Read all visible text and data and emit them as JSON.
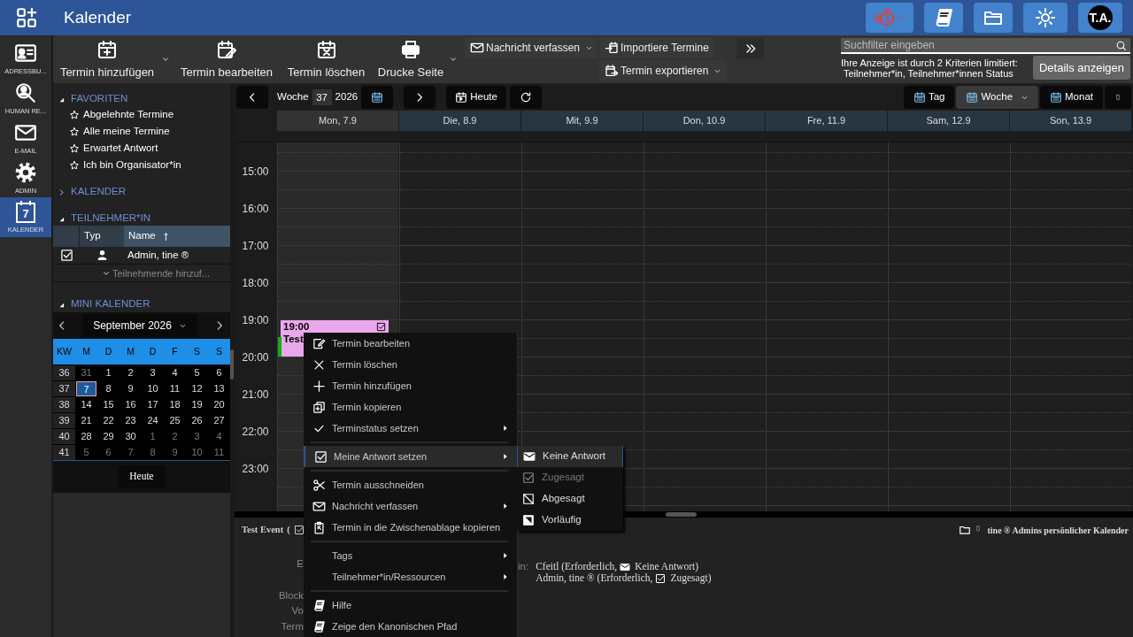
{
  "app": {
    "title": "Kalender"
  },
  "header_buttons": [
    {
      "kind": "stopwatch",
      "dropdown": true
    },
    {
      "kind": "book",
      "dropdown": false
    },
    {
      "kind": "folder-open",
      "dropdown": false
    },
    {
      "kind": "sun",
      "dropdown": false
    }
  ],
  "user": {
    "initials": "T.A."
  },
  "nav": [
    {
      "label": "ADRESSBU...",
      "kind": "address-card",
      "selected": false
    },
    {
      "label": "HUMAN RE...",
      "kind": "person-search",
      "selected": false
    },
    {
      "label": "E-MAIL",
      "kind": "envelope",
      "selected": false
    },
    {
      "label": "ADMIN",
      "kind": "gear",
      "selected": false
    },
    {
      "label": "KALENDER",
      "kind": "calendar",
      "icon_text": "7",
      "selected": true
    }
  ],
  "toolbar": {
    "buttons": [
      {
        "label": "Termin hinzufügen",
        "kind": "calendar-plus",
        "dropdown": true
      },
      {
        "label": "Termin bearbeiten",
        "kind": "calendar-edit",
        "dropdown": false
      },
      {
        "label": "Termin löschen",
        "kind": "calendar-x",
        "dropdown": false
      },
      {
        "label": "Drucke Seite",
        "kind": "printer",
        "dropdown": true
      }
    ],
    "actions": [
      {
        "label": "Nachricht verfassen",
        "kind": "envelope",
        "dropdown": true
      },
      {
        "label": "Importiere Termine",
        "kind": "import",
        "dropdown": false
      },
      {
        "label": "Termin exportieren",
        "kind": "export",
        "dropdown": true
      }
    ],
    "search": {
      "placeholder": "Suchfilter eingeben"
    },
    "filter_notice": [
      "Ihre Anzeige ist durch 2 Kriterien limitiert:",
      "Teilnehmer*in, Teilnehmer*innen Status"
    ],
    "details_button": "Details anzeigen"
  },
  "favorites": {
    "title": "FAVORITEN",
    "expanded": true,
    "items": [
      "Abgelehnte Termine",
      "Alle meine Termine",
      "Erwartet Antwort",
      "Ich bin Organisator*in"
    ]
  },
  "calendars": {
    "title": "KALENDER",
    "expanded": false
  },
  "attendees": {
    "title": "TEILNEHMER*IN",
    "expanded": true,
    "columns": [
      {
        "label": "Typ",
        "sorted": false
      },
      {
        "label": "Name",
        "sorted": true
      }
    ],
    "rows": [
      {
        "checked": true,
        "kind": "user",
        "name": "Admin, tine ®"
      }
    ],
    "add_placeholder": "Teilnehmende hinzuf..."
  },
  "mini_calendar": {
    "title": "MINI KALENDER",
    "expanded": true,
    "month": "September 2026",
    "weekday_header": [
      "KW",
      "M",
      "D",
      "M",
      "D",
      "F",
      "S",
      "S"
    ],
    "weeks": [
      {
        "kw": "36",
        "days": [
          {
            "d": "31",
            "muted": true,
            "selected": false
          },
          {
            "d": "1",
            "muted": false,
            "selected": false
          },
          {
            "d": "2",
            "muted": false,
            "selected": false
          },
          {
            "d": "3",
            "muted": false,
            "selected": false
          },
          {
            "d": "4",
            "muted": false,
            "selected": false
          },
          {
            "d": "5",
            "muted": false,
            "selected": false
          },
          {
            "d": "6",
            "muted": false,
            "selected": false
          }
        ]
      },
      {
        "kw": "37",
        "days": [
          {
            "d": "7",
            "muted": false,
            "selected": true
          },
          {
            "d": "8",
            "muted": false,
            "selected": false
          },
          {
            "d": "9",
            "muted": false,
            "selected": false
          },
          {
            "d": "10",
            "muted": false,
            "selected": false
          },
          {
            "d": "11",
            "muted": false,
            "selected": false
          },
          {
            "d": "12",
            "muted": false,
            "selected": false
          },
          {
            "d": "13",
            "muted": false,
            "selected": false
          }
        ]
      },
      {
        "kw": "38",
        "days": [
          {
            "d": "14",
            "muted": false,
            "selected": false
          },
          {
            "d": "15",
            "muted": false,
            "selected": false
          },
          {
            "d": "16",
            "muted": false,
            "selected": false
          },
          {
            "d": "17",
            "muted": false,
            "selected": false
          },
          {
            "d": "18",
            "muted": false,
            "selected": false
          },
          {
            "d": "19",
            "muted": false,
            "selected": false
          },
          {
            "d": "20",
            "muted": false,
            "selected": false
          }
        ]
      },
      {
        "kw": "39",
        "days": [
          {
            "d": "21",
            "muted": false,
            "selected": false
          },
          {
            "d": "22",
            "muted": false,
            "selected": false
          },
          {
            "d": "23",
            "muted": false,
            "selected": false
          },
          {
            "d": "24",
            "muted": false,
            "selected": false
          },
          {
            "d": "25",
            "muted": false,
            "selected": false
          },
          {
            "d": "26",
            "muted": false,
            "selected": false
          },
          {
            "d": "27",
            "muted": false,
            "selected": false
          }
        ]
      },
      {
        "kw": "40",
        "days": [
          {
            "d": "28",
            "muted": false,
            "selected": false
          },
          {
            "d": "29",
            "muted": false,
            "selected": false
          },
          {
            "d": "30",
            "muted": false,
            "selected": false
          },
          {
            "d": "1",
            "muted": true,
            "selected": false
          },
          {
            "d": "2",
            "muted": true,
            "selected": false
          },
          {
            "d": "3",
            "muted": true,
            "selected": false
          },
          {
            "d": "4",
            "muted": true,
            "selected": false
          }
        ]
      },
      {
        "kw": "41",
        "days": [
          {
            "d": "5",
            "muted": true,
            "selected": false
          },
          {
            "d": "6",
            "muted": true,
            "selected": false
          },
          {
            "d": "7",
            "muted": true,
            "selected": false
          },
          {
            "d": "8",
            "muted": true,
            "selected": false
          },
          {
            "d": "9",
            "muted": true,
            "selected": false
          },
          {
            "d": "10",
            "muted": true,
            "selected": false
          },
          {
            "d": "11",
            "muted": true,
            "selected": false
          }
        ]
      }
    ],
    "today_button": "Heute"
  },
  "week_nav": {
    "label": "Woche",
    "week": "37",
    "year": "2026",
    "today_button": "Heute",
    "views": [
      {
        "label": "Tag",
        "selected": false,
        "dropdown": false
      },
      {
        "label": "Woche",
        "selected": true,
        "dropdown": true
      },
      {
        "label": "Monat",
        "selected": false,
        "dropdown": false
      }
    ]
  },
  "days": [
    {
      "label": "Mon, 7.9",
      "selected": true,
      "events": [
        {
          "time": "19:00",
          "title": "Test",
          "checked": true
        }
      ]
    },
    {
      "label": "Die, 8.9",
      "selected": false
    },
    {
      "label": "Mit, 9.9",
      "selected": false
    },
    {
      "label": "Don, 10.9",
      "selected": false
    },
    {
      "label": "Fre, 11.9",
      "selected": false
    },
    {
      "label": "Sam, 12.9",
      "selected": false
    },
    {
      "label": "Son, 13.9",
      "selected": false
    }
  ],
  "hours": [
    "15:00",
    "16:00",
    "17:00",
    "18:00",
    "19:00",
    "20:00",
    "21:00",
    "22:00",
    "23:00"
  ],
  "detail": {
    "title": "Test Event",
    "paren": "(",
    "labels": [
      "E",
      "Block",
      "Vo",
      "Term"
    ],
    "attendee_label": "in:",
    "attendees": [
      {
        "name": "Cfeitl (Erforderlich,",
        "kind": "pending",
        "status": "Keine Antwort)"
      },
      {
        "name": "Admin, tine ® (Erforderlich,",
        "kind": "accepted",
        "status": "Zugesagt)"
      }
    ],
    "calendar": "tine ® Admins persönlicher Kalender"
  },
  "context_menu": {
    "groups": [
      [
        {
          "label": "Termin bearbeiten",
          "kind": "note-edit",
          "submenu": false,
          "selected": false
        },
        {
          "label": "Termin löschen",
          "kind": "x",
          "submenu": false,
          "selected": false
        },
        {
          "label": "Termin hinzufügen",
          "kind": "plus",
          "submenu": false,
          "selected": false
        },
        {
          "label": "Termin kopieren",
          "kind": "copy",
          "submenu": false,
          "selected": false
        },
        {
          "label": "Terminstatus setzen",
          "kind": "check",
          "submenu": true,
          "selected": false
        }
      ],
      [
        {
          "label": "Meine Antwort setzen",
          "kind": "checkbox-checked",
          "submenu": true,
          "selected": true
        }
      ],
      [
        {
          "label": "Termin ausschneiden",
          "kind": "scissors",
          "submenu": false,
          "selected": false
        },
        {
          "label": "Nachricht verfassen",
          "kind": "envelope",
          "submenu": true,
          "selected": false
        },
        {
          "label": "Termin in die Zwischenablage kopieren",
          "kind": "clipboard",
          "submenu": false,
          "selected": false
        }
      ],
      [
        {
          "label": "Tags",
          "kind": "plain",
          "submenu": true,
          "selected": false
        },
        {
          "label": "Teilnehmer*in/Ressourcen",
          "kind": "plain",
          "submenu": true,
          "selected": false
        }
      ],
      [
        {
          "label": "Hilfe",
          "kind": "book",
          "submenu": false,
          "selected": false
        },
        {
          "label": "Zeige den Kanonischen Pfad",
          "kind": "book",
          "submenu": false,
          "selected": false
        }
      ]
    ]
  },
  "submenu": {
    "items": [
      {
        "label": "Keine Antwort",
        "kind": "envelope-filled",
        "selected": true,
        "disabled": false
      },
      {
        "label": "Zugesagt",
        "kind": "checkbox-checked",
        "selected": false,
        "disabled": true
      },
      {
        "label": "Abgesagt",
        "kind": "square-slash",
        "selected": false,
        "disabled": false
      },
      {
        "label": "Vorläufig",
        "kind": "square-half",
        "selected": false,
        "disabled": false
      }
    ]
  }
}
